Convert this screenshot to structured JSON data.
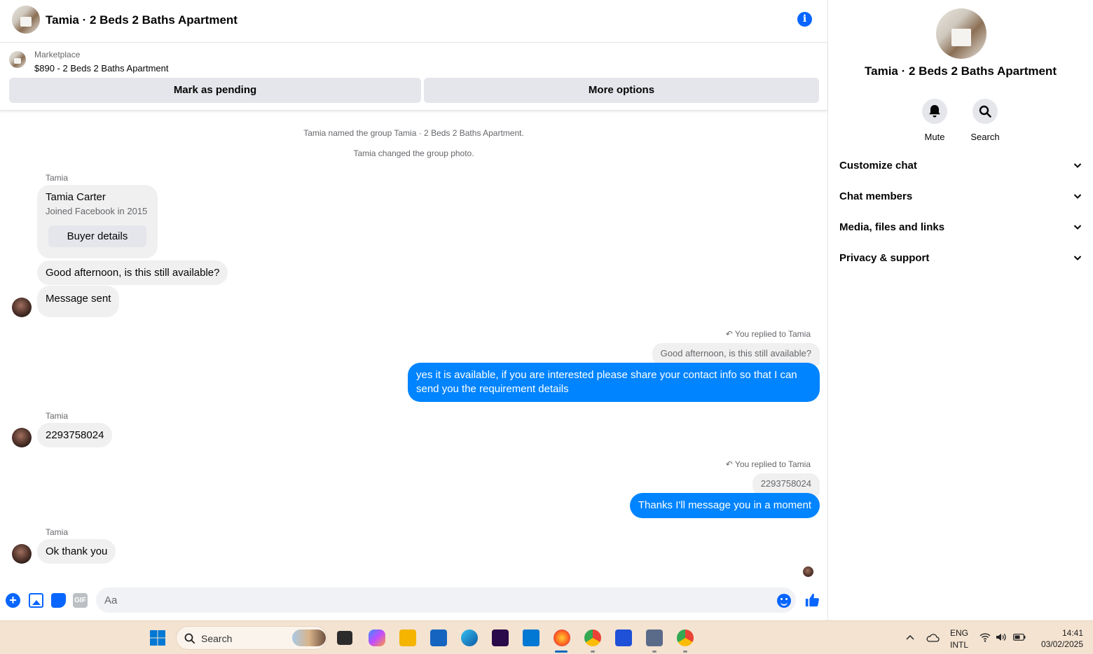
{
  "chat": {
    "title": "Tamia · 2 Beds 2 Baths Apartment",
    "listing": {
      "source": "Marketplace",
      "title": "$890 - 2 Beds 2 Baths Apartment",
      "mark_pending_label": "Mark as pending",
      "more_options_label": "More options"
    },
    "system_messages": [
      "Tamia named the group Tamia · 2 Beds 2 Baths Apartment.",
      "Tamia changed the group photo."
    ],
    "sender_name": "Tamia",
    "buyer_card": {
      "name": "Tamia Carter",
      "subtitle": "Joined Facebook in 2015",
      "button_label": "Buyer details"
    },
    "messages": {
      "incoming_1": "Good afternoon, is this still available?",
      "incoming_2": "Message sent",
      "reply_note_1": "You replied to Tamia",
      "quote_1": "Good afternoon, is this still available?",
      "outgoing_1": "yes it is available, if you are interested please share your contact info so that I can send you the requirement details",
      "incoming_3": "2293758024",
      "reply_note_2": "You replied to Tamia",
      "quote_2": "2293758024",
      "outgoing_2": "Thanks I'll message you in a moment",
      "incoming_4": "Ok thank you"
    },
    "composer": {
      "placeholder": "Aa",
      "gif_label": "GIF"
    }
  },
  "info_panel": {
    "title": "Tamia · 2 Beds 2 Baths Apartment",
    "actions": {
      "mute_label": "Mute",
      "search_label": "Search"
    },
    "sections": [
      {
        "label": "Customize chat"
      },
      {
        "label": "Chat members"
      },
      {
        "label": "Media, files and links"
      },
      {
        "label": "Privacy & support"
      }
    ]
  },
  "taskbar": {
    "search_label": "Search",
    "language": "ENG",
    "layout": "INTL",
    "time": "14:41",
    "date": "03/02/2025"
  },
  "colors": {
    "messenger_blue": "#0084ff",
    "accent_blue": "#0866ff",
    "bubble_grey": "#f0f0f0",
    "taskbar_bg": "#f4e3d1"
  },
  "icons": {
    "header": "info-icon",
    "composer": [
      "plus-icon",
      "gallery-icon",
      "sticker-icon",
      "gif-icon",
      "emoji-icon",
      "thumbs-up-icon"
    ],
    "panel_actions": [
      "bell-icon",
      "search-icon"
    ],
    "reply": "reply-arrow-icon"
  }
}
